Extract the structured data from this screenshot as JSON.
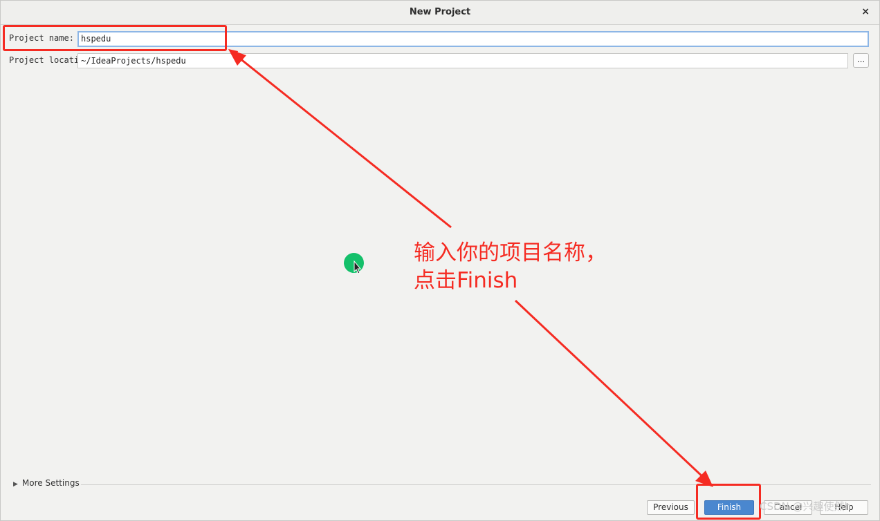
{
  "window": {
    "title": "New Project",
    "close_glyph": "×"
  },
  "form": {
    "name_label": "Project name:",
    "name_value": "hspedu",
    "location_label": "Project location:",
    "location_value": "~/IdeaProjects/hspedu",
    "browse_label": "..."
  },
  "more_settings": {
    "label": "More Settings",
    "icon": "triangle-right-icon"
  },
  "buttons": {
    "previous": "Previous",
    "finish": "Finish",
    "cancel": "Cancel",
    "help": "Help"
  },
  "annotation": {
    "line1": "输入你的项目名称，",
    "line2": "点击Finish",
    "color": "#f52b22"
  },
  "watermark": "CSDN @兴趣使然h",
  "colors": {
    "accent": "#4a87cf",
    "focus": "#8db6e6"
  }
}
